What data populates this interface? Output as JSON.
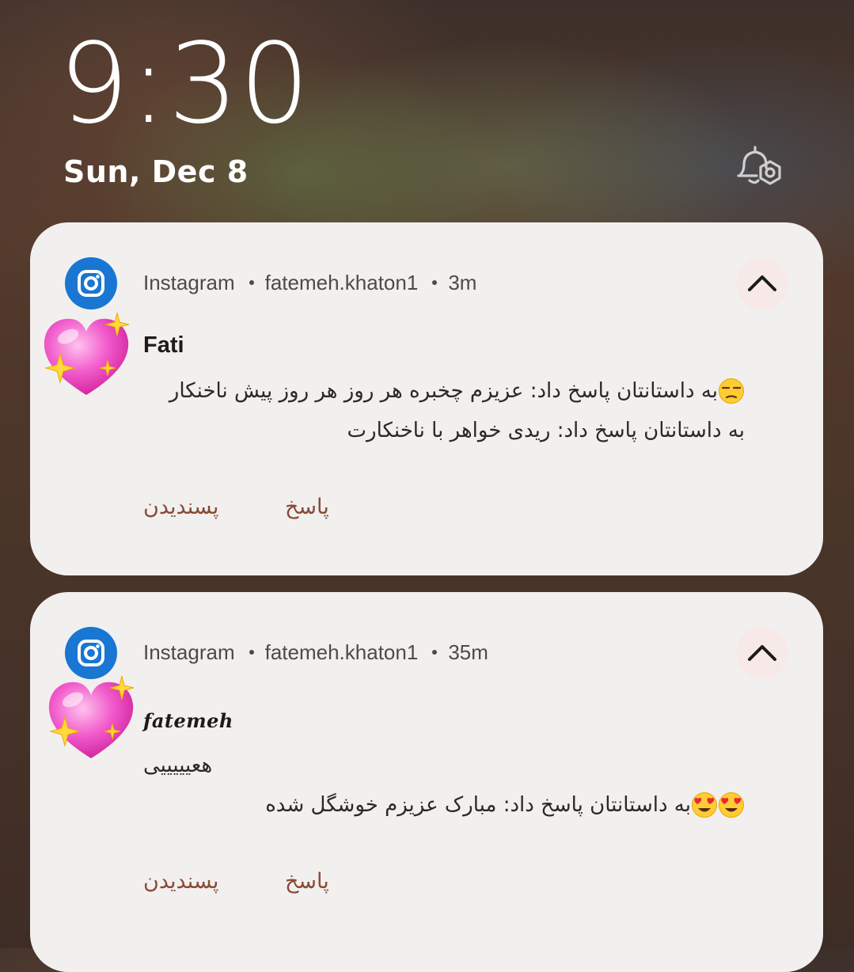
{
  "lock_screen": {
    "time": "9:30",
    "date": "Sun, Dec 8"
  },
  "colors": {
    "card_background": "#f1f0ef",
    "instagram_icon_bg": "#1976d2",
    "action_text": "#8a4a33",
    "collapse_button_bg": "#f7e9e7"
  },
  "notifications": [
    {
      "app_name": "Instagram",
      "account": "fatemeh.khaton1",
      "time_ago": "3m",
      "app_icon": "instagram-icon",
      "avatar_icon": "sparkling-heart-icon",
      "sender": "Fati",
      "messages": [
        {
          "text": "به داستانتان پاسخ داد: عزیزم چخبره هر روز هر روز پیش ناخنکار",
          "emoji": "unamused-face-icon"
        },
        {
          "text": "به داستانتان پاسخ داد: ریدی خواهر با ناخنکارت",
          "emoji": ""
        }
      ],
      "actions": [
        {
          "label": "پاسخ"
        },
        {
          "label": "پسندیدن"
        }
      ]
    },
    {
      "app_name": "Instagram",
      "account": "fatemeh.khaton1",
      "time_ago": "35m",
      "app_icon": "instagram-icon",
      "avatar_icon": "sparkling-heart-icon",
      "sender": "fatemeh",
      "messages": [
        {
          "text": "هعیییییی",
          "emoji": ""
        },
        {
          "text": "به داستانتان پاسخ داد: مبارک عزیزم خوشگل شده",
          "emoji": "heart-eyes-face-icon"
        }
      ],
      "actions": [
        {
          "label": "پاسخ"
        },
        {
          "label": "پسندیدن"
        }
      ]
    }
  ]
}
